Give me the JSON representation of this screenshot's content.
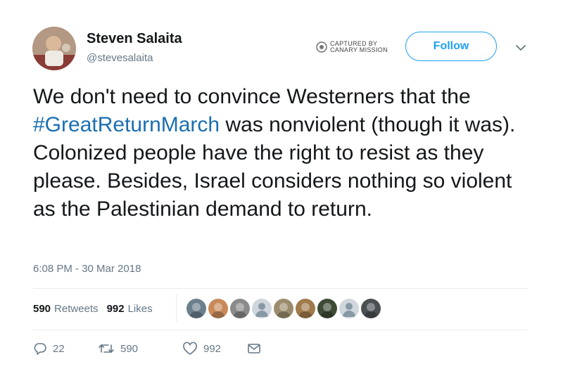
{
  "profile": {
    "name": "Steven Salaita",
    "handle": "@stevesalaita"
  },
  "captured": {
    "line1": "CAPTURED BY",
    "line2": "CANARY MISSION"
  },
  "follow_label": "Follow",
  "tweet": {
    "text_before": "We don't need to convince Westerners that the ",
    "hashtag": "#GreatReturnMarch",
    "text_after": " was nonviolent (though it was).  Colonized people have the right to resist as they please.  Besides, Israel considers nothing so violent as the Palestinian demand to return."
  },
  "timestamp": "6:08 PM - 30 Mar 2018",
  "stats": {
    "retweets_count": "590",
    "retweets_label": "Retweets",
    "likes_count": "992",
    "likes_label": "Likes"
  },
  "likers": [
    {
      "icon": "liker-avatar-1",
      "color": "#6b7f8c"
    },
    {
      "icon": "liker-avatar-2",
      "color": "#c98a5a"
    },
    {
      "icon": "liker-avatar-3",
      "color": "#8a8a8a"
    },
    {
      "icon": "default-avatar-icon",
      "color": "#cfd6dc"
    },
    {
      "icon": "liker-avatar-5",
      "color": "#9b8c6e"
    },
    {
      "icon": "liker-avatar-6",
      "color": "#a07a4a"
    },
    {
      "icon": "liker-avatar-7",
      "color": "#3d4a35"
    },
    {
      "icon": "default-avatar-icon",
      "color": "#cfd6dc"
    },
    {
      "icon": "liker-avatar-9",
      "color": "#4a4f52"
    }
  ],
  "actions": {
    "replies": "22",
    "retweets": "590",
    "likes": "992"
  },
  "colors": {
    "accent": "#1da1f2",
    "hashtag": "#1b6fb0",
    "muted": "#657786"
  }
}
